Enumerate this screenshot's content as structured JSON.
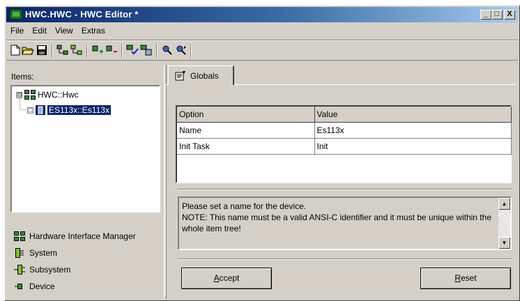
{
  "window": {
    "title": "HWC.HWC - HWC Editor  *",
    "controls": {
      "minimize": "_",
      "maximize": "□",
      "close": "X"
    }
  },
  "menu": [
    "File",
    "Edit",
    "View",
    "Extras"
  ],
  "toolbar": {
    "icons": [
      "new-file-icon",
      "open-folder-icon",
      "save-icon",
      "add-system-icon",
      "add-subsystem-icon",
      "add-device-icon",
      "remove-device-icon",
      "check-icon",
      "generate-icon",
      "find-icon",
      "find-next-icon"
    ]
  },
  "left": {
    "items_label": "Items:",
    "tree": {
      "root": {
        "label": "HWC::Hwc",
        "expander": "⊟"
      },
      "child": {
        "label": "ES113x::Es113x",
        "expander": "□"
      }
    },
    "legend": [
      {
        "label": "Hardware Interface Manager",
        "icon": "hwi-manager-icon"
      },
      {
        "label": "System",
        "icon": "system-icon"
      },
      {
        "label": "Subsystem",
        "icon": "subsystem-icon"
      },
      {
        "label": "Device",
        "icon": "device-icon"
      }
    ]
  },
  "right": {
    "tab_label": "Globals",
    "table": {
      "headers": [
        "Option",
        "Value"
      ],
      "rows": [
        [
          "Name",
          "Es113x"
        ],
        [
          "Init Task",
          "Init"
        ]
      ]
    },
    "description": "Please set a name for the device.\nNOTE: This name must be a valid ANSI-C identifier and it must be unique within the whole item tree!",
    "accept": {
      "hotkey": "A",
      "rest": "ccept"
    },
    "reset": {
      "hotkey": "R",
      "rest": "eset"
    }
  }
}
